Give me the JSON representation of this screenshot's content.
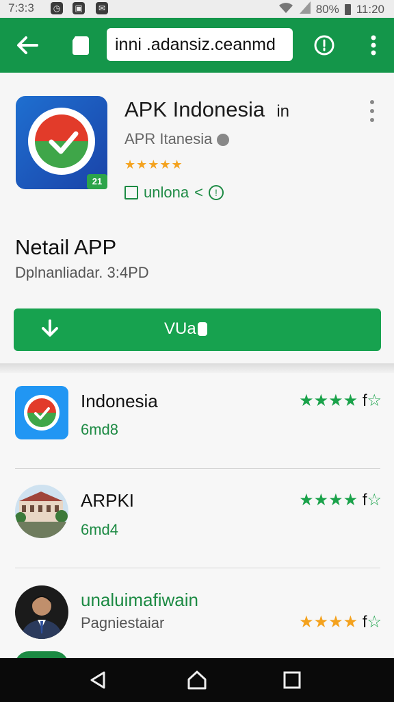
{
  "status_bar": {
    "time": "7:3:3",
    "battery": "80%",
    "clock": "11:20",
    "icons": [
      "clock-icon",
      "notification-icon",
      "mail-icon",
      "wifi-icon",
      "signal-icon",
      "battery-icon"
    ]
  },
  "toolbar": {
    "url": "inni .adansiz.ceanmd",
    "icons": [
      "back-arrow-icon",
      "tab-icon",
      "info-icon",
      "more-vert-icon"
    ]
  },
  "app": {
    "title": "APK Indonesia",
    "title_suffix": "in",
    "developer": "APR Itanesia",
    "rating_stars": "★★★★★",
    "tag": "unlona",
    "icon_badge": "21"
  },
  "detail": {
    "title": "Netail APP",
    "subtitle": "Dplnanliadar. 3:4PD"
  },
  "download": {
    "label": "VUa"
  },
  "list": [
    {
      "title": "Indonesia",
      "sub": "6md8",
      "stars": "★★★★",
      "suffix": "f",
      "empty": "☆",
      "icon": "app-logo-icon"
    },
    {
      "title": "ARPKI",
      "sub": "6md4",
      "stars": "★★★★",
      "suffix": "f",
      "empty": "☆",
      "icon": "building-photo-icon"
    },
    {
      "title": "unaluimafiwain",
      "sub": "Pagniestaiar",
      "stars": "★★★★",
      "suffix": "f",
      "empty": "☆",
      "icon": "person-avatar-icon"
    }
  ],
  "colors": {
    "primary": "#14964a",
    "button": "#17a24f",
    "star_gold": "#f4a21e",
    "star_green": "#1aa24a"
  },
  "nav": {
    "icons": [
      "nav-back-icon",
      "nav-home-icon",
      "nav-recents-icon"
    ]
  }
}
